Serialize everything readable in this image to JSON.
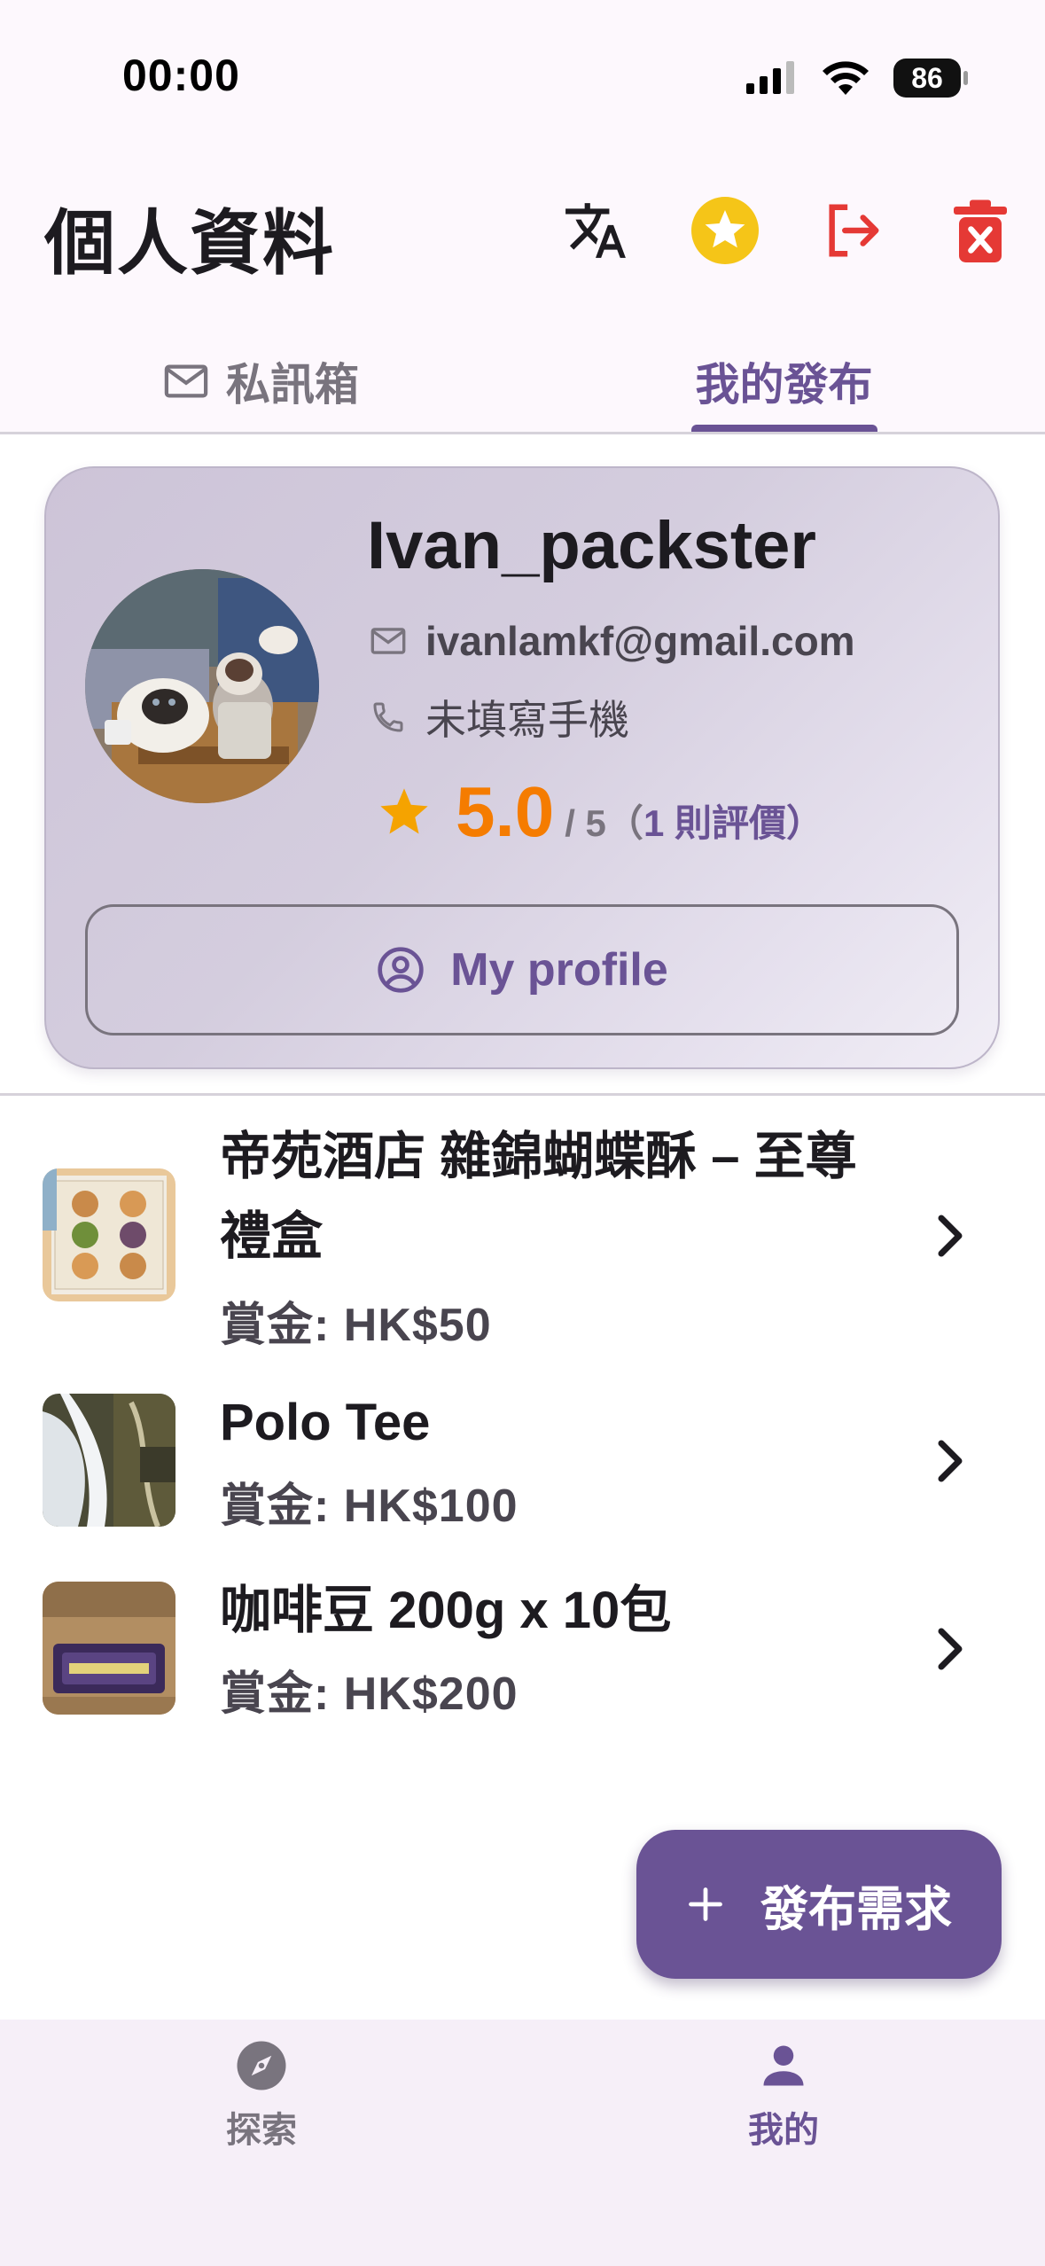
{
  "status_bar": {
    "time": "00:00",
    "battery": "86"
  },
  "header": {
    "title": "個人資料"
  },
  "tabs": [
    {
      "label": "私訊箱",
      "icon": "mail-icon",
      "selected": false
    },
    {
      "label": "我的發布",
      "selected": true
    }
  ],
  "profile": {
    "username": "Ivan_packster",
    "email": "ivanlamkf@gmail.com",
    "phone": "未填寫手機",
    "rating": {
      "score": "5.0",
      "out_of": "/ 5",
      "count_prefix": "（",
      "count": "1",
      "count_suffix": " 則評價）"
    },
    "profile_button_label": "My profile"
  },
  "posts": [
    {
      "title": "帝苑酒店 雜錦蝴蝶酥 – 至尊禮盒",
      "reward": "賞金: HK$50"
    },
    {
      "title": "Polo Tee",
      "reward": "賞金: HK$100"
    },
    {
      "title": "咖啡豆 200g x 10包",
      "reward": "賞金: HK$200"
    }
  ],
  "fab": {
    "label": "發布需求"
  },
  "bottom_nav": [
    {
      "label": "探索",
      "icon": "compass-icon",
      "selected": false
    },
    {
      "label": "我的",
      "icon": "person-icon",
      "selected": true
    }
  ],
  "colors": {
    "accent": "#6a5395",
    "rating": "#f57c00",
    "danger": "#e53935",
    "star": "#f5c518"
  }
}
